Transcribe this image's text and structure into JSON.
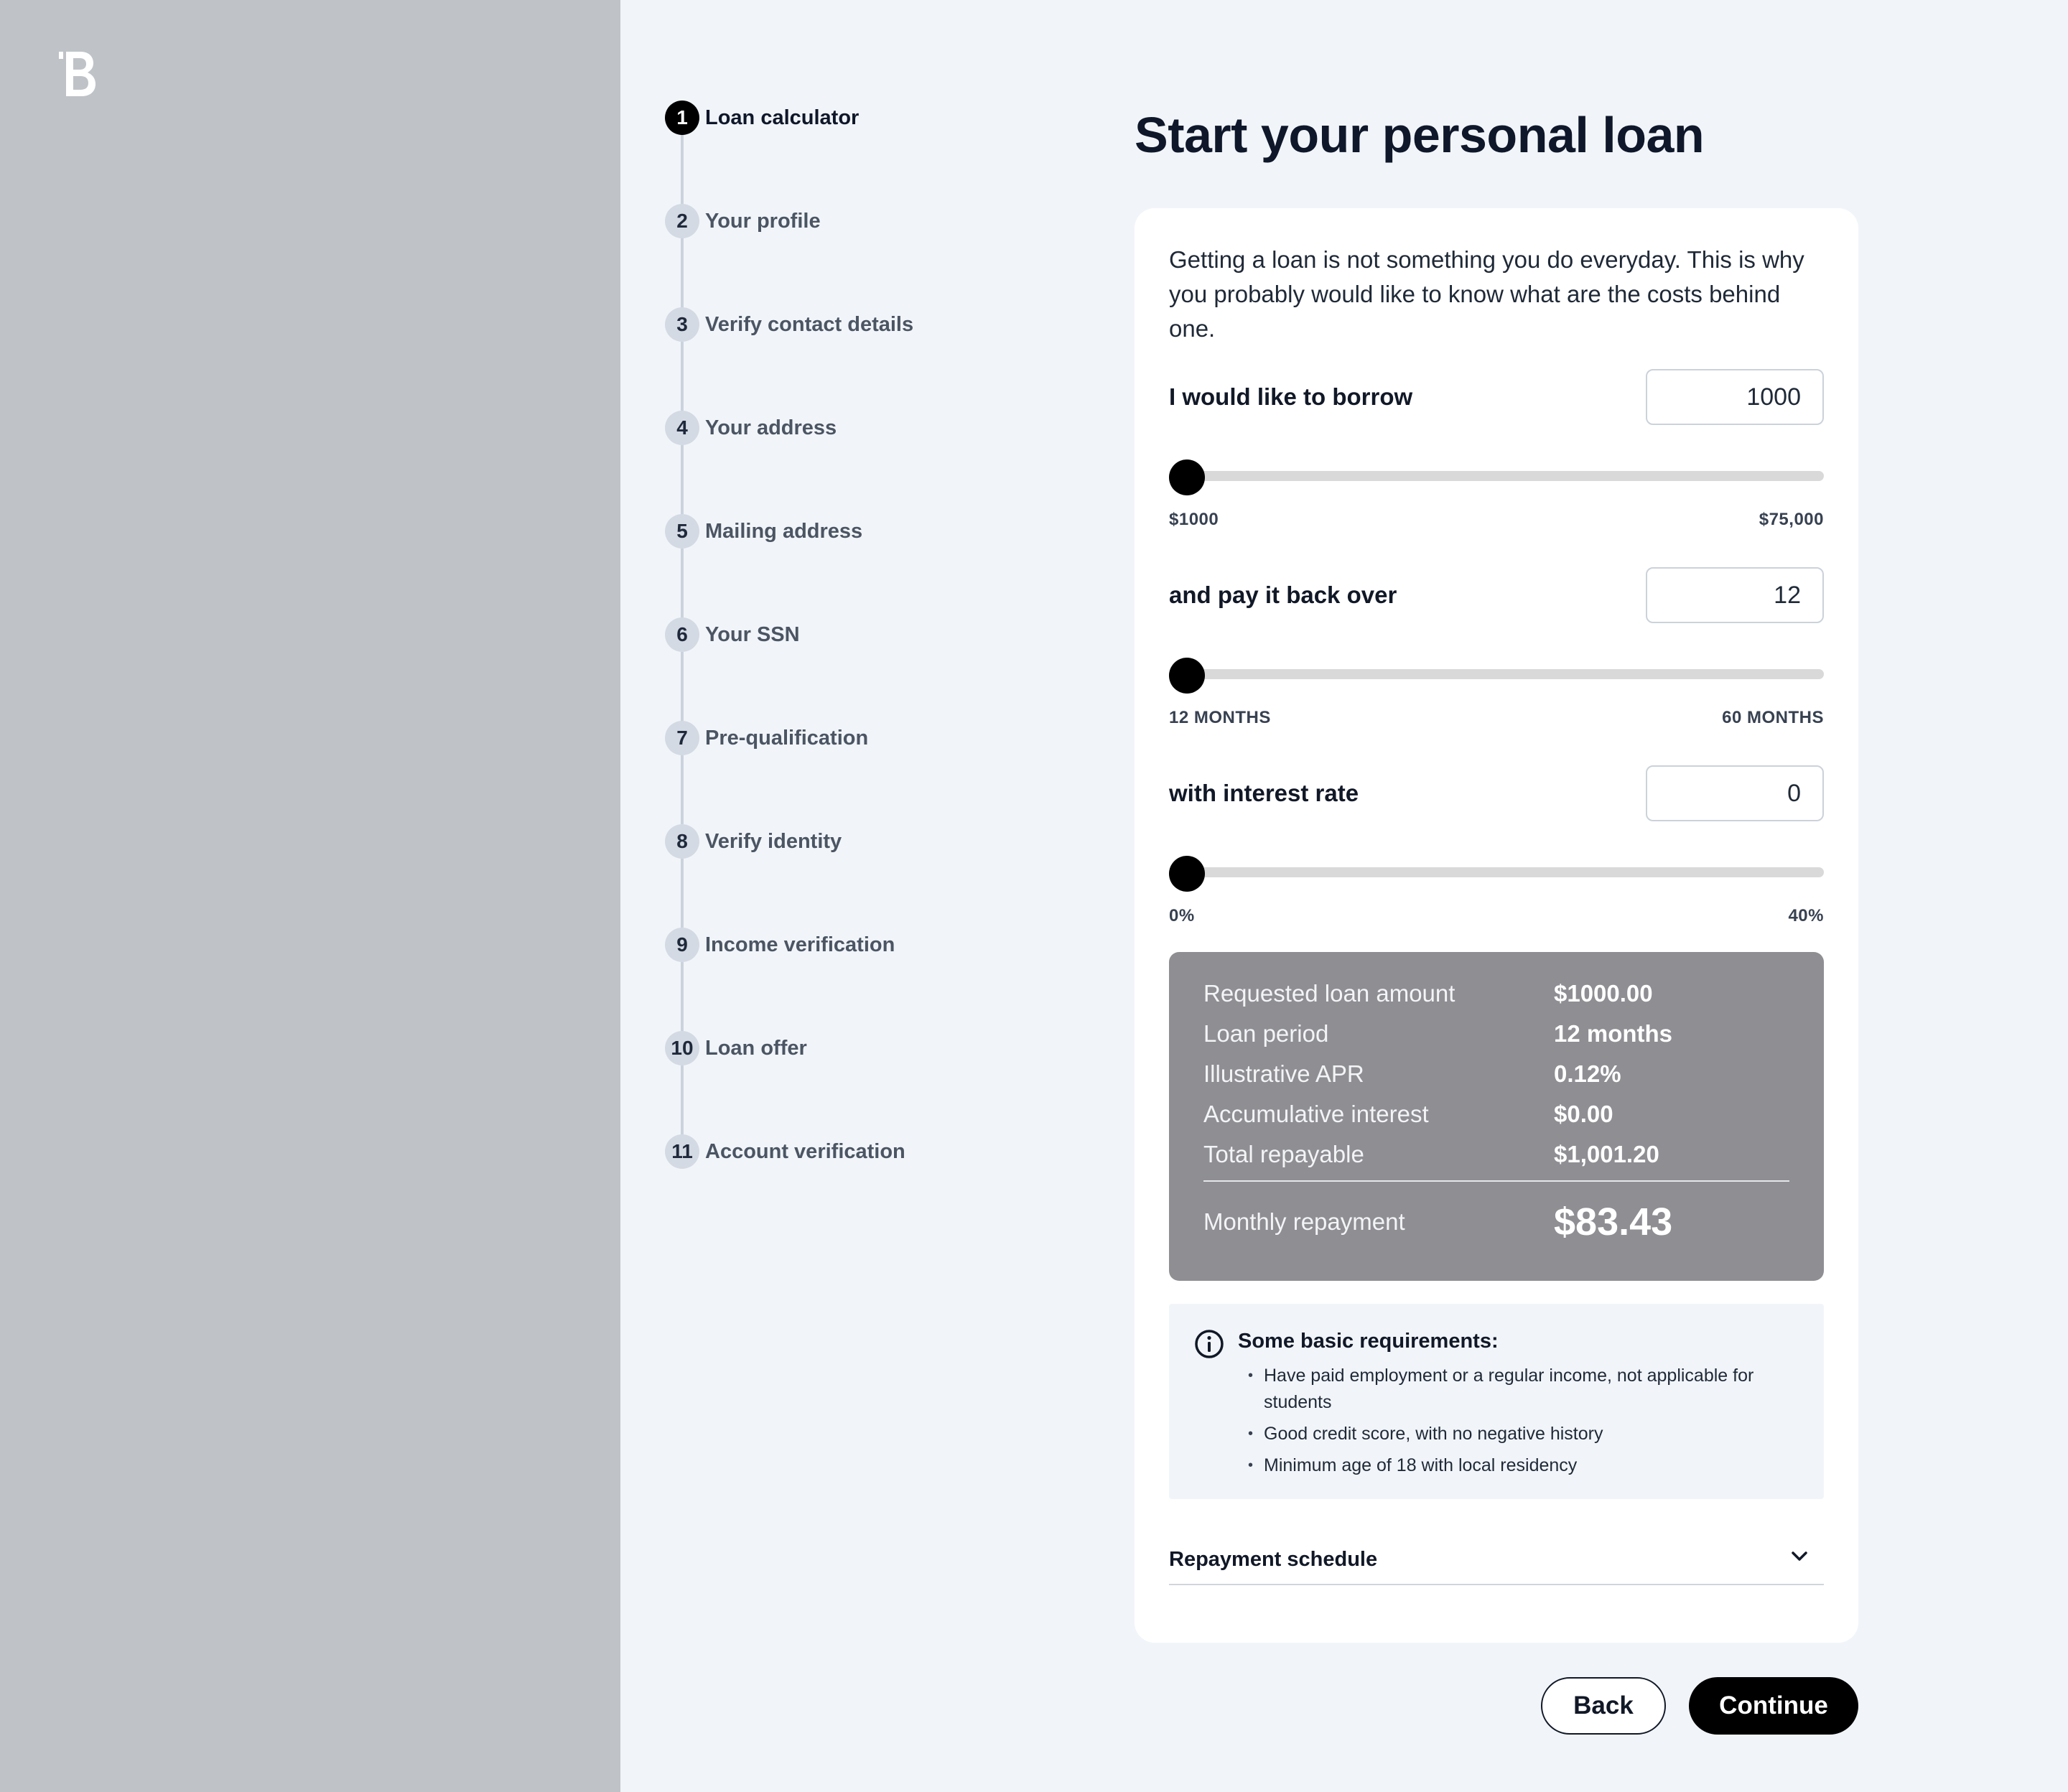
{
  "brand": {
    "logo_icon": "brand-b-logo-icon"
  },
  "steps": [
    {
      "num": "1",
      "label": "Loan calculator",
      "active": true
    },
    {
      "num": "2",
      "label": "Your profile"
    },
    {
      "num": "3",
      "label": "Verify contact details"
    },
    {
      "num": "4",
      "label": "Your address"
    },
    {
      "num": "5",
      "label": "Mailing address"
    },
    {
      "num": "6",
      "label": "Your SSN"
    },
    {
      "num": "7",
      "label": "Pre-qualification"
    },
    {
      "num": "8",
      "label": "Verify identity"
    },
    {
      "num": "9",
      "label": "Income verification"
    },
    {
      "num": "10",
      "label": "Loan offer"
    },
    {
      "num": "11",
      "label": "Account verification"
    }
  ],
  "title": "Start your personal loan",
  "intro": "Getting a loan is not something you do everyday. This is why you probably would like to know what are the costs behind one.",
  "borrow": {
    "label": "I would like to borrow",
    "value": "1000",
    "min_label": "$1000",
    "max_label": "$75,000",
    "level": 0
  },
  "period": {
    "label": "and pay it back over",
    "value": "12",
    "min_label": "12 MONTHS",
    "max_label": "60 MONTHS",
    "level": 0
  },
  "rate": {
    "label": "with interest rate",
    "value": "0",
    "min_label": "0%",
    "max_label": "40%",
    "level": 0
  },
  "summary": {
    "requested_label": "Requested loan amount",
    "requested_value": "$1000.00",
    "period_label": "Loan period",
    "period_value": "12 months",
    "apr_label": "Illustrative APR",
    "apr_value": "0.12%",
    "interest_label": "Accumulative interest",
    "interest_value": "$0.00",
    "total_label": "Total repayable",
    "total_value": "$1,001.20",
    "monthly_label": "Monthly repayment",
    "monthly_value": "$83.43"
  },
  "requirements": {
    "title": "Some basic requirements:",
    "items": [
      "Have paid employment or a regular income, not applicable for students",
      "Good credit score, with no negative history",
      "Minimum age of 18 with local residency"
    ]
  },
  "schedule": {
    "label": "Repayment schedule"
  },
  "buttons": {
    "back": "Back",
    "continue": "Continue"
  },
  "colors": {
    "accent": "#000000",
    "summary_bg": "#8e8e93",
    "panel": "#bfc3c7",
    "background": "#f1f5f9"
  }
}
